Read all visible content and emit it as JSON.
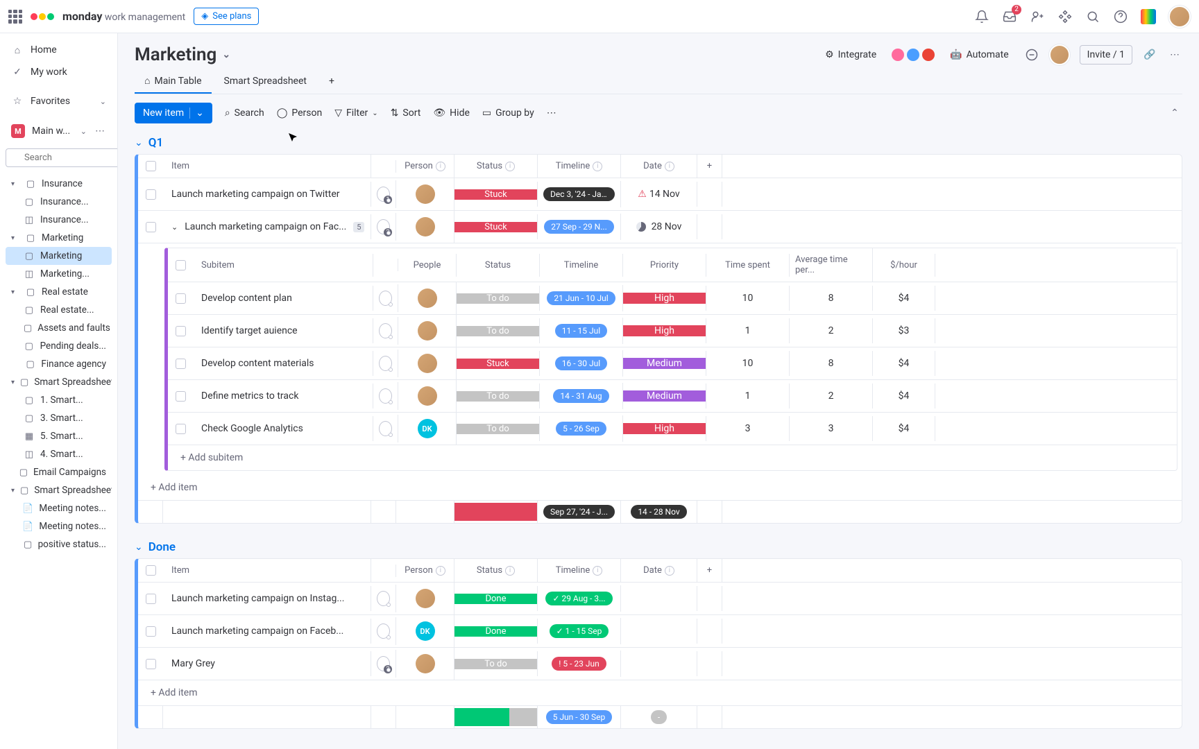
{
  "topbar": {
    "brand": "monday",
    "brand_sub": "work management",
    "see_plans": "See plans",
    "inbox_badge": "2",
    "invite": "Invite / 1"
  },
  "sidebar": {
    "home": "Home",
    "my_work": "My work",
    "favorites": "Favorites",
    "workspace": "Main w...",
    "search_placeholder": "Search",
    "tree": [
      {
        "label": "Insurance",
        "expandable": true,
        "children": [
          {
            "label": "Insurance...",
            "icon": "board"
          },
          {
            "label": "Insurance...",
            "icon": "chart"
          }
        ]
      },
      {
        "label": "Marketing",
        "expandable": true,
        "children": [
          {
            "label": "Marketing",
            "icon": "board",
            "selected": true
          },
          {
            "label": "Marketing...",
            "icon": "chart"
          }
        ]
      },
      {
        "label": "Real estate",
        "expandable": true,
        "children": [
          {
            "label": "Real estate...",
            "icon": "board"
          },
          {
            "label": "Assets and faults",
            "icon": "board"
          },
          {
            "label": "Pending deals...",
            "icon": "board"
          }
        ]
      },
      {
        "label": "Finance agency",
        "icon": "board"
      },
      {
        "label": "Smart Spreadsheet...",
        "expandable": true,
        "children": [
          {
            "label": "1. Smart...",
            "icon": "board"
          },
          {
            "label": "3. Smart...",
            "icon": "board"
          },
          {
            "label": "5. Smart...",
            "icon": "sheet"
          },
          {
            "label": "4. Smart...",
            "icon": "chart"
          }
        ]
      },
      {
        "label": "Email Campaigns",
        "icon": "board"
      },
      {
        "label": "Smart Spreadsheet...",
        "expandable": true
      },
      {
        "label": "Meeting notes...",
        "icon": "doc"
      },
      {
        "label": "Meeting notes...",
        "icon": "doc"
      },
      {
        "label": "positive status...",
        "icon": "board"
      }
    ]
  },
  "board": {
    "title": "Marketing",
    "integrate": "Integrate",
    "automate": "Automate",
    "tabs": [
      {
        "label": "Main Table",
        "active": true,
        "icon": "home"
      },
      {
        "label": "Smart Spreadsheet"
      }
    ],
    "toolbar": {
      "new_item": "New item",
      "search": "Search",
      "person": "Person",
      "filter": "Filter",
      "sort": "Sort",
      "hide": "Hide",
      "group_by": "Group by"
    }
  },
  "groups": {
    "q1": {
      "title": "Q1",
      "columns": [
        "Item",
        "Person",
        "Status",
        "Timeline",
        "Date"
      ],
      "rows": [
        {
          "name": "Launch marketing campaign on Twitter",
          "chat": "1",
          "status": "Stuck",
          "status_color": "#e2445c",
          "timeline": "Dec 3, '24 - Ja...",
          "tl_class": "",
          "date": "14 Nov",
          "date_warn": true
        },
        {
          "name": "Launch marketing campaign on Fac...",
          "chat": "2",
          "sub_count": "5",
          "expanded": true,
          "status": "Stuck",
          "status_color": "#e2445c",
          "timeline": "27 Sep - 29 N...",
          "tl_class": "timeline-blue",
          "date": "28 Nov",
          "date_prog": true
        }
      ],
      "sub_columns": [
        "Subitem",
        "People",
        "Status",
        "Timeline",
        "Priority",
        "Time spent",
        "Average time per...",
        "$/hour"
      ],
      "subitems": [
        {
          "name": "Develop content plan",
          "status": "To do",
          "status_color": "#c4c4c4",
          "timeline": "21 Jun - 10 Jul",
          "priority": "High",
          "pri_color": "#e2445c",
          "time": "10",
          "avg": "8",
          "rate": "$4"
        },
        {
          "name": "Identify target auience",
          "status": "To do",
          "status_color": "#c4c4c4",
          "timeline": "11 - 15 Jul",
          "priority": "High",
          "pri_color": "#e2445c",
          "time": "1",
          "avg": "2",
          "rate": "$3",
          "avatar_badge": true
        },
        {
          "name": "Develop content materials",
          "status": "Stuck",
          "status_color": "#e2445c",
          "timeline": "16 - 30 Jul",
          "priority": "Medium",
          "pri_color": "#a25ddc",
          "time": "10",
          "avg": "8",
          "rate": "$4"
        },
        {
          "name": "Define metrics to track",
          "status": "To do",
          "status_color": "#c4c4c4",
          "timeline": "14 - 31 Aug",
          "priority": "Medium",
          "pri_color": "#a25ddc",
          "time": "1",
          "avg": "2",
          "rate": "$4"
        },
        {
          "name": "Check Google Analytics",
          "status": "To do",
          "status_color": "#c4c4c4",
          "timeline": "5 - 26 Sep",
          "priority": "High",
          "pri_color": "#e2445c",
          "time": "3",
          "avg": "3",
          "rate": "$4",
          "dk": true
        }
      ],
      "add_subitem": "+ Add subitem",
      "add_item": "+ Add item",
      "summary": {
        "timeline": "Sep 27, '24 - J...",
        "date": "14 - 28 Nov"
      }
    },
    "done": {
      "title": "Done",
      "columns": [
        "Item",
        "Person",
        "Status",
        "Timeline",
        "Date"
      ],
      "rows": [
        {
          "name": "Launch marketing campaign on Instag...",
          "status": "Done",
          "status_color": "#00c875",
          "timeline": "✓ 29 Aug - 3...",
          "tl_class": "timeline-green"
        },
        {
          "name": "Launch marketing campaign on Faceb...",
          "status": "Done",
          "status_color": "#00c875",
          "timeline": "✓ 1 - 15 Sep",
          "tl_class": "timeline-green",
          "dk": true
        },
        {
          "name": "Mary Grey",
          "chat": "2",
          "status": "To do",
          "status_color": "#c4c4c4",
          "timeline": "! 5 - 23 Jun",
          "tl_class": "timeline-red",
          "avatar_badge": true
        }
      ],
      "add_item": "+ Add item",
      "summary": {
        "timeline": "5 Jun - 30 Sep",
        "date": "-"
      }
    }
  }
}
